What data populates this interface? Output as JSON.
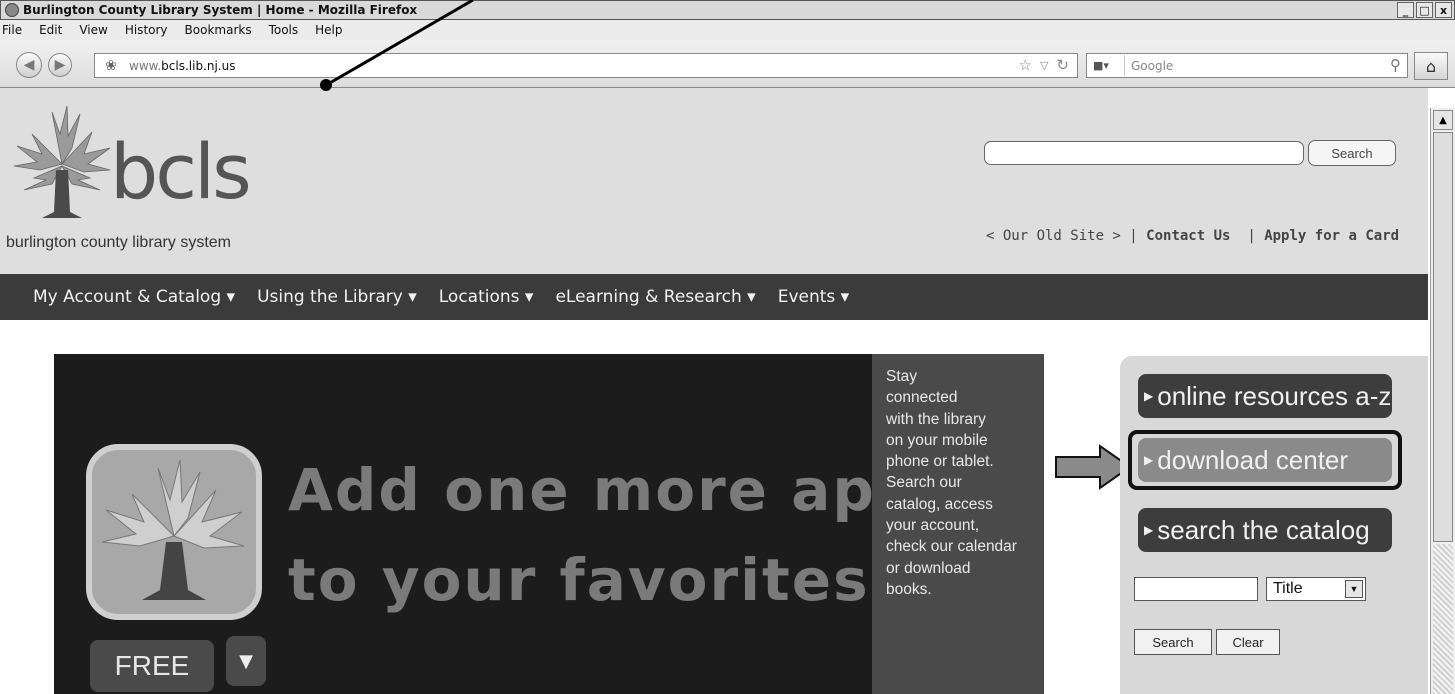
{
  "window": {
    "title": "Burlington County Library System | Home - Mozilla Firefox",
    "minimize": "_",
    "maximize": "□",
    "close": "x"
  },
  "menu": [
    "File",
    "Edit",
    "View",
    "History",
    "Bookmarks",
    "Tools",
    "Help"
  ],
  "browser": {
    "url_prefix": "www.",
    "url_domain": "bcls.lib.nj.us",
    "search_engine": "Google"
  },
  "header": {
    "logo_text": "bcls",
    "logo_sub": "burlington county library system",
    "search_button": "Search",
    "links": [
      "< Our Old Site >",
      "Contact Us",
      "Apply for a Card"
    ]
  },
  "nav": [
    "My Account & Catalog ▾",
    "Using the Library ▾",
    "Locations ▾",
    "eLearning & Research ▾",
    "Events ▾"
  ],
  "banner": {
    "line1": "Add one more app",
    "line2": "to your favorites...",
    "free_label": "FREE",
    "side_lines": [
      "Stay",
      "connected",
      "with the library",
      "on your mobile",
      "phone or tablet.",
      "Search our",
      "catalog, access",
      "your account,",
      "check our calendar",
      "or download",
      "books."
    ]
  },
  "side_panel": {
    "btn1": "online resources a-z",
    "btn2": "download center",
    "btn3": "search the catalog",
    "catalog_select": "Title",
    "search_btn": "Search",
    "clear_btn": "Clear"
  },
  "icons": [
    "firefox-icon",
    "back-icon",
    "forward-icon",
    "site-icon",
    "star-icon",
    "reload-icon",
    "google-icon",
    "search-icon",
    "home-icon"
  ]
}
